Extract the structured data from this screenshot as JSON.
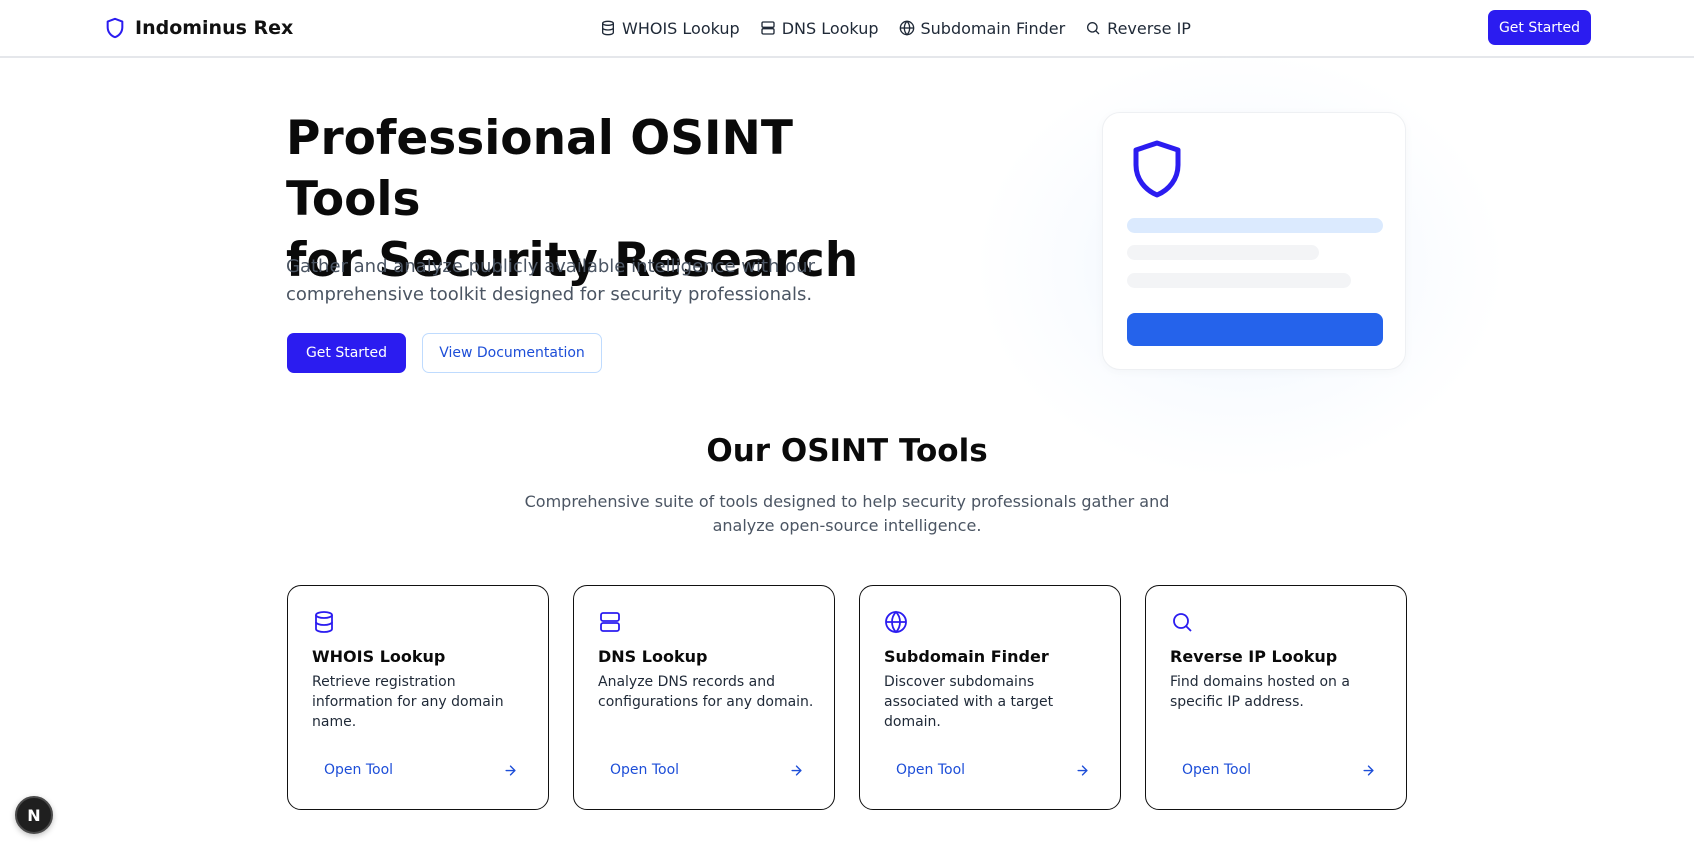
{
  "header": {
    "brand": "Indominus Rex",
    "nav": [
      {
        "label": "WHOIS Lookup",
        "icon": "database-icon"
      },
      {
        "label": "DNS Lookup",
        "icon": "server-icon"
      },
      {
        "label": "Subdomain Finder",
        "icon": "globe-icon"
      },
      {
        "label": "Reverse IP",
        "icon": "search-icon"
      }
    ],
    "cta": "Get Started"
  },
  "hero": {
    "title_line1": "Professional OSINT Tools",
    "title_line2": "for Security Research",
    "subtitle": "Gather and analyze publicly available intelligence with our comprehensive toolkit designed for security professionals.",
    "primary_button": "Get Started",
    "secondary_button": "View Documentation"
  },
  "tools_section": {
    "title": "Our OSINT Tools",
    "subtitle": "Comprehensive suite of tools designed to help security professionals gather and analyze open-source intelligence."
  },
  "tools": [
    {
      "name": "WHOIS Lookup",
      "description": "Retrieve registration information for any domain name.",
      "link": "Open Tool",
      "icon": "database-icon"
    },
    {
      "name": "DNS Lookup",
      "description": "Analyze DNS records and configurations for any domain.",
      "link": "Open Tool",
      "icon": "server-icon"
    },
    {
      "name": "Subdomain Finder",
      "description": "Discover subdomains associated with a target domain.",
      "link": "Open Tool",
      "icon": "globe-icon"
    },
    {
      "name": "Reverse IP Lookup",
      "description": "Find domains hosted on a specific IP address.",
      "link": "Open Tool",
      "icon": "search-icon"
    }
  ],
  "dev_badge": "N",
  "colors": {
    "accent": "#2b1cf0",
    "link": "#1d4ed8",
    "text_muted": "#4b5563"
  }
}
